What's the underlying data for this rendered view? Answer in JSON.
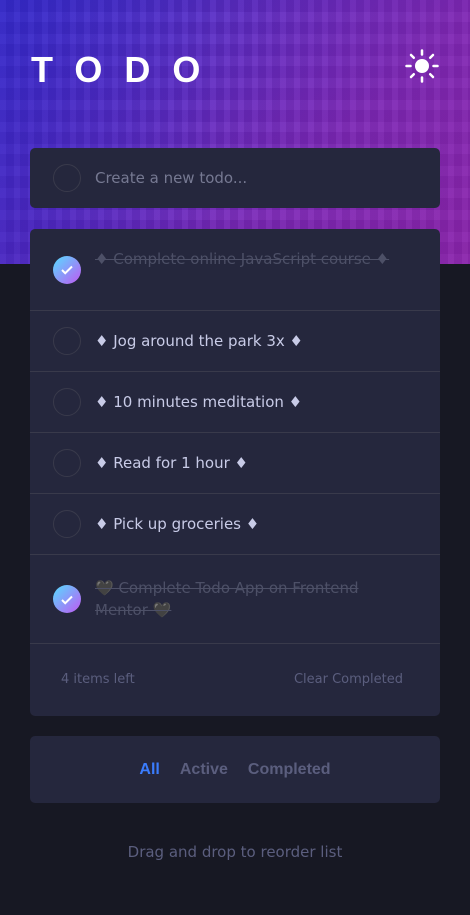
{
  "header": {
    "title": "TODO",
    "theme_toggle_icon": "sun-icon"
  },
  "create": {
    "placeholder": "Create a new todo..."
  },
  "todos": [
    {
      "text": "♦ Complete online JavaScript course ♦",
      "completed": true
    },
    {
      "text": "♦ Jog around the park 3x ♦",
      "completed": false
    },
    {
      "text": "♦ 10 minutes meditation ♦",
      "completed": false
    },
    {
      "text": "♦ Read for 1 hour ♦",
      "completed": false
    },
    {
      "text": "♦ Pick up groceries ♦",
      "completed": false
    },
    {
      "text": "🖤 Complete Todo App on Frontend Mentor 🖤",
      "completed": true
    }
  ],
  "footer": {
    "items_left": "4 items left",
    "clear_label": "Clear Completed"
  },
  "filters": {
    "all": "All",
    "active": "Active",
    "completed": "Completed",
    "selected": "All"
  },
  "hint": "Drag and drop to reorder list",
  "colors": {
    "accent": "#3a7cfd",
    "check_gradient_start": "#55ddff",
    "check_gradient_end": "#c058f3",
    "card": "#25273d",
    "background": "#171823"
  }
}
